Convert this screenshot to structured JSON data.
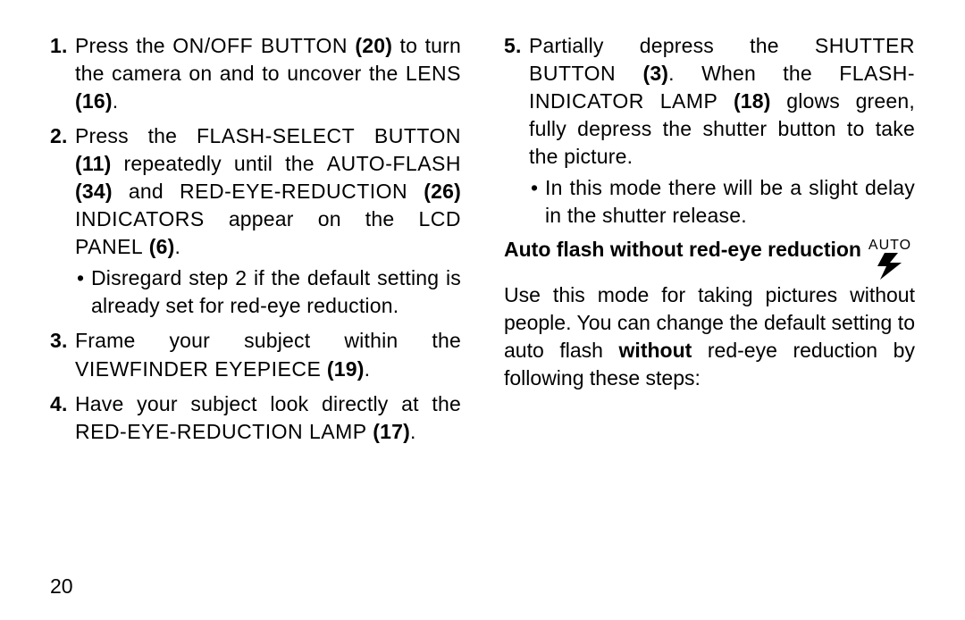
{
  "pageNumber": "20",
  "left": {
    "step1": {
      "num": "1.",
      "t1": "Press the ",
      "sc1": "ON/OFF BUTTON",
      "b1": " (20)",
      "t2": " to turn the camera on and to uncover the ",
      "sc2": "LENS",
      "b2": " (16)",
      "t3": "."
    },
    "step2": {
      "num": "2.",
      "t1": "Press the ",
      "sc1": "FLASH-SELECT BUTTON",
      "b1": " (11)",
      "t2": " repeatedly until the ",
      "sc2": "AUTO-FLASH",
      "b2": " (34)",
      "t3": " and ",
      "sc3": "RED-EYE-REDUCTION",
      "b3": " (26)",
      "sc4": " INDICATORS",
      "t4": " appear on the ",
      "sc5": "LCD PANEL",
      "b4": " (6)",
      "t5": ".",
      "sub1": "Disregard step 2 if the default setting is already set for red-eye reduction."
    },
    "step3": {
      "num": "3.",
      "t1": "Frame your subject within the ",
      "sc1": "VIEWFINDER EYEPIECE",
      "b1": " (19)",
      "t2": "."
    },
    "step4": {
      "num": "4.",
      "t1": "Have your subject look directly at the ",
      "sc1": "RED-EYE-REDUCTION LAMP",
      "b1": " (17)",
      "t2": "."
    }
  },
  "right": {
    "step5": {
      "num": "5.",
      "t1": "Partially depress the ",
      "sc1": "SHUTTER BUTTON",
      "b1": " (3)",
      "t2": ". When the ",
      "sc2": "FLASH-INDICATOR LAMP",
      "b2": " (18)",
      "t3": " glows green, fully depress the shutter button to take the picture.",
      "sub1": "In this mode there will be a slight delay in the shutter release."
    },
    "section": {
      "title": "Auto flash without red-eye reduction",
      "iconLabel": "AUTO"
    },
    "para": {
      "t1": "Use this mode for taking pictures without people. You can change the default setting to auto flash ",
      "b1": "without",
      "t2": " red-eye reduction by following these steps:"
    }
  }
}
